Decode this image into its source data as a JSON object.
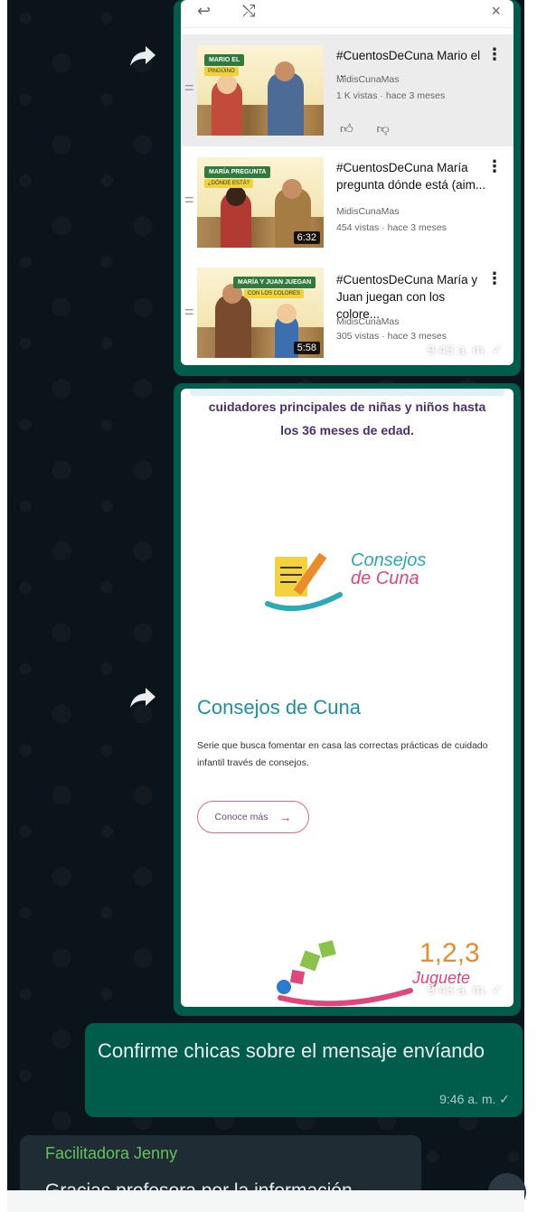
{
  "youtube_card": {
    "videos": [
      {
        "title": "#CuentosDeCuna Mario el ...",
        "channel": "MidisCunaMas",
        "meta": "1 K vistas · hace 3 meses",
        "thumb_tag": "MARIO EL",
        "thumb_tag2": "PINGÜINO"
      },
      {
        "title_line1": "#CuentosDeCuna María",
        "title_line2": "pregunta dónde está (aim...",
        "channel": "MidisCunaMas",
        "meta": "454 vistas · hace 3 meses",
        "duration": "6:32",
        "thumb_tag": "MARÍA PREGUNTA",
        "thumb_tag2": "¿DÓNDE ESTÁ?"
      },
      {
        "title_line1": "#CuentosDeCuna María y",
        "title_line2": "Juan juegan con los colore...",
        "channel": "MidisCunaMas",
        "meta": "305 vistas · hace 3 meses",
        "duration": "5:58",
        "thumb_tag": "MARÍA Y JUAN JUEGAN",
        "thumb_tag2": "CON LOS COLORES"
      }
    ],
    "timestamp": "9:43 a. m. ✓"
  },
  "consejos_card": {
    "top_line1": "cuidadores principales de niñas y niños hasta",
    "top_line2": "los 36 meses de edad.",
    "logo_line1": "Consejos",
    "logo_line2": "de Cuna",
    "heading": "Consejos de Cuna",
    "description": "Serie que busca fomentar en casa las correctas prácticas de cuidado infantil través de consejos.",
    "button_label": "Conoce más",
    "button_arrow": "→",
    "juguete_number": "1,2,3",
    "juguete_word": "Juguete",
    "timestamp": "9:43 a. m. ✓"
  },
  "text_message": {
    "text": "Confirme chicas sobre el mensaje envíando",
    "timestamp": "9:46 a. m. ✓"
  },
  "incoming_message": {
    "sender": "Facilitadora Jenny",
    "preview": "Gracias profesora por la información"
  },
  "icons": {
    "forward": "forward-arrow-icon",
    "kebab": "more-vert-icon",
    "like": "thumb-up-icon",
    "dislike": "thumb-down-icon"
  },
  "colors": {
    "outgoing_bubble": "#005c4b",
    "incoming_bubble": "#202c33",
    "background": "#0b141a",
    "sender_name": "#62c25e"
  }
}
